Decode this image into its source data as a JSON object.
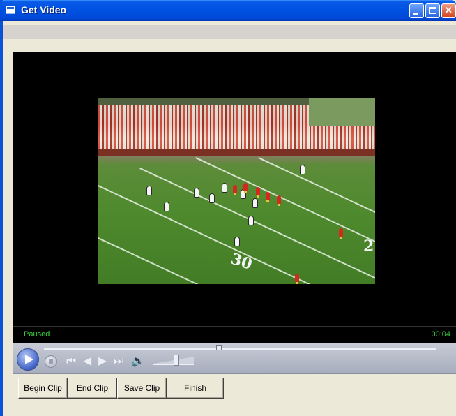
{
  "window": {
    "title": "Get Video"
  },
  "player": {
    "status": "Paused",
    "time": "00:04"
  },
  "video": {
    "yard_numbers": [
      "30",
      "2"
    ]
  },
  "controls": {
    "icons": [
      "play-icon",
      "stop-icon",
      "skip-back-icon",
      "rewind-icon",
      "fast-forward-icon",
      "skip-forward-icon",
      "mute-icon",
      "volume-slider"
    ]
  },
  "buttons": {
    "begin_clip": "Begin Clip",
    "end_clip": "End Clip",
    "save_clip": "Save Clip",
    "finish": "Finish"
  }
}
